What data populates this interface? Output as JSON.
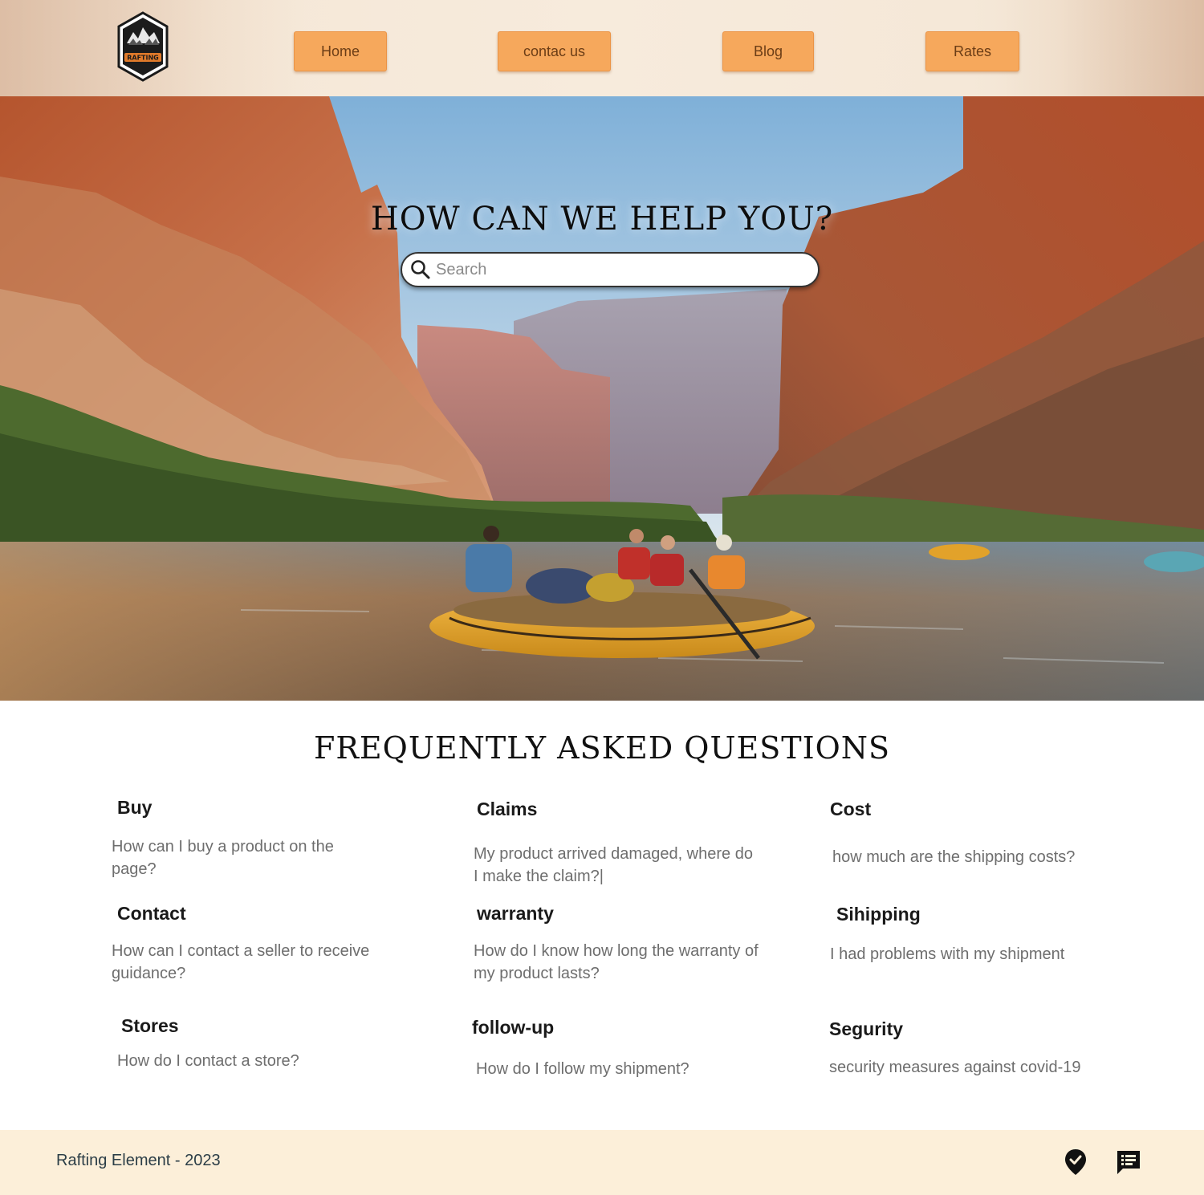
{
  "nav": {
    "logo_text": "RAFTING",
    "items": [
      {
        "label": "Home"
      },
      {
        "label": "contac us"
      },
      {
        "label": "Blog"
      },
      {
        "label": "Rates"
      }
    ]
  },
  "hero": {
    "title": "HOW CAN WE HELP YOU?",
    "search_placeholder": "Search",
    "search_icon": "search-icon"
  },
  "faq": {
    "title": "FREQUENTLY ASKED QUESTIONS",
    "items": [
      {
        "title": "Buy",
        "text": "How can I buy a product on the page?"
      },
      {
        "title": "Claims",
        "text": "My product arrived damaged, where do I make the claim?|"
      },
      {
        "title": "Cost",
        "text": "how much are the shipping costs?"
      },
      {
        "title": "Contact",
        "text": "How can I contact a seller to receive guidance?"
      },
      {
        "title": "warranty",
        "text": "How do I know how long the warranty of my product lasts?"
      },
      {
        "title": "Sihipping",
        "text": "I had problems with my shipment"
      },
      {
        "title": "Stores",
        "text": "How do I contact a store?"
      },
      {
        "title": "follow-up",
        "text": "How do I follow my shipment?"
      },
      {
        "title": "Segurity",
        "text": "security measures against covid-19"
      }
    ]
  },
  "footer": {
    "copyright": "Rafting Element  -  2023",
    "icons": [
      "location-pin-icon",
      "chat-message-icon"
    ]
  },
  "colors": {
    "nav_button": "#f6a85c",
    "header_bg": "#f5e8d8",
    "footer_bg": "#fcefd9"
  }
}
